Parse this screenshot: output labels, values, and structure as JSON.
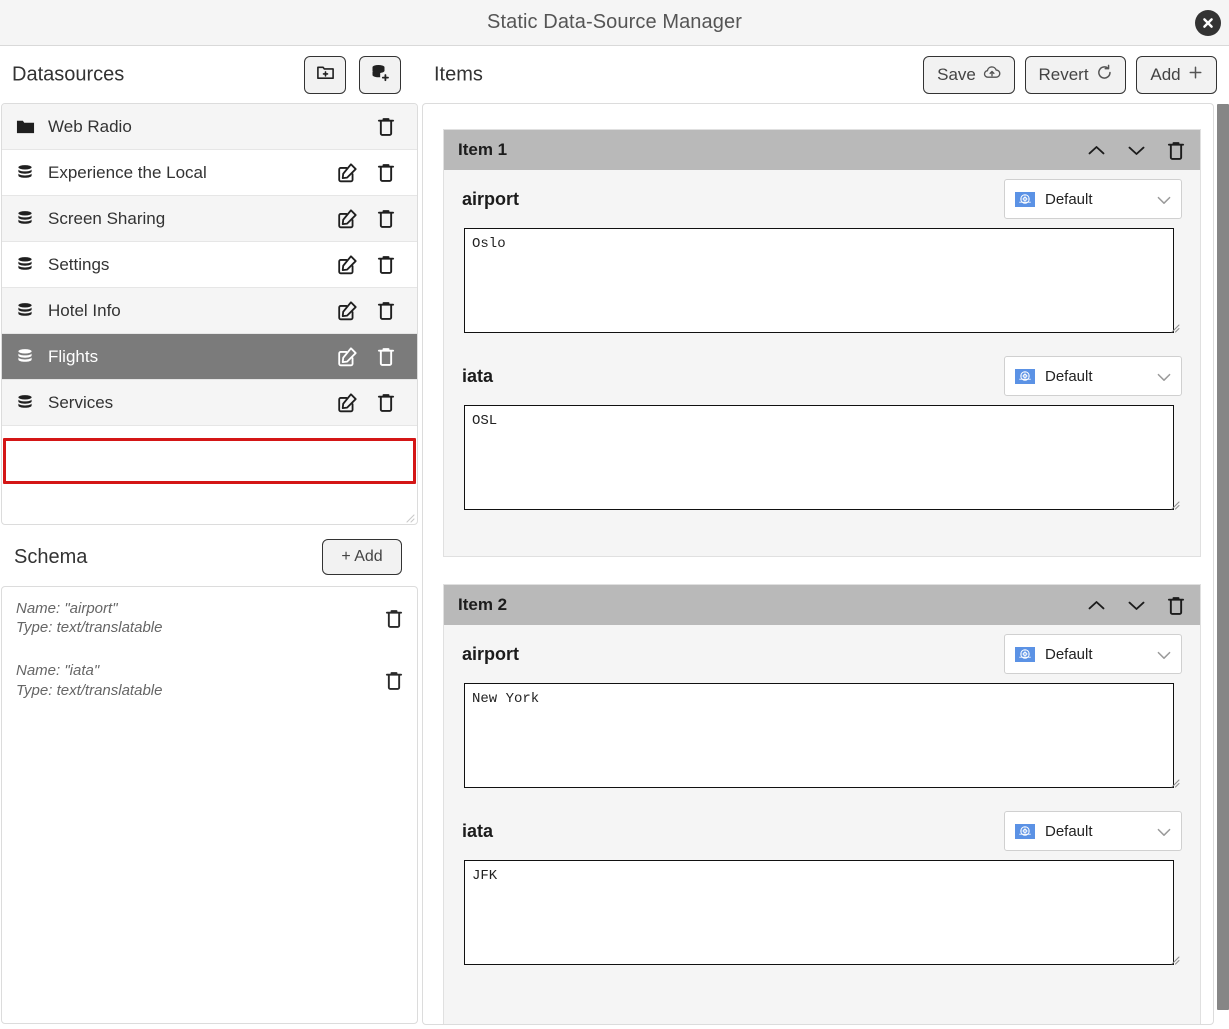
{
  "window": {
    "title": "Static Data-Source Manager",
    "close_icon": "close-icon"
  },
  "toolbar": {
    "datasources_label": "Datasources",
    "add_folder_icon": "folder-plus-icon",
    "add_datasource_icon": "database-plus-icon",
    "items_label": "Items",
    "save_label": "Save",
    "save_icon": "cloud-upload-icon",
    "revert_label": "Revert",
    "revert_icon": "refresh-icon",
    "add_label": "Add",
    "add_icon": "plus-icon"
  },
  "datasources": {
    "items": [
      {
        "name": "Web Radio",
        "icon": "folder-icon",
        "editable": false,
        "selected": false
      },
      {
        "name": "Experience the Local",
        "icon": "database-icon",
        "editable": true,
        "selected": false
      },
      {
        "name": "Screen Sharing",
        "icon": "database-icon",
        "editable": true,
        "selected": false
      },
      {
        "name": "Settings",
        "icon": "database-icon",
        "editable": true,
        "selected": false
      },
      {
        "name": "Hotel Info",
        "icon": "database-icon",
        "editable": true,
        "selected": false
      },
      {
        "name": "Flights",
        "icon": "database-icon",
        "editable": true,
        "selected": true
      },
      {
        "name": "Services",
        "icon": "database-icon",
        "editable": true,
        "selected": false
      }
    ],
    "selected_highlight_color": "#d41616",
    "selected_row_bg": "#7b7b7b"
  },
  "schema": {
    "title": "Schema",
    "add_label": "+ Add",
    "entries": [
      {
        "name_line": "Name: \"airport\"",
        "type_line": "Type: text/translatable"
      },
      {
        "name_line": "Name: \"iata\"",
        "type_line": "Type: text/translatable"
      }
    ]
  },
  "items_panel": {
    "cards": [
      {
        "title": "Item 1",
        "move_up_icon": "chevron-up-icon",
        "move_down_icon": "chevron-down-icon",
        "delete_icon": "trash-icon",
        "fields": [
          {
            "label": "airport",
            "language": "Default",
            "language_icon": "un-flag-icon",
            "value": "Oslo"
          },
          {
            "label": "iata",
            "language": "Default",
            "language_icon": "un-flag-icon",
            "value": "OSL"
          }
        ]
      },
      {
        "title": "Item 2",
        "move_up_icon": "chevron-up-icon",
        "move_down_icon": "chevron-down-icon",
        "delete_icon": "trash-icon",
        "fields": [
          {
            "label": "airport",
            "language": "Default",
            "language_icon": "un-flag-icon",
            "value": "New York"
          },
          {
            "label": "iata",
            "language": "Default",
            "language_icon": "un-flag-icon",
            "value": "JFK"
          }
        ]
      }
    ]
  },
  "colors": {
    "header_bar": "#f5f5f5",
    "item_header": "#b9b9b9",
    "flag_blue": "#5b92e5"
  }
}
